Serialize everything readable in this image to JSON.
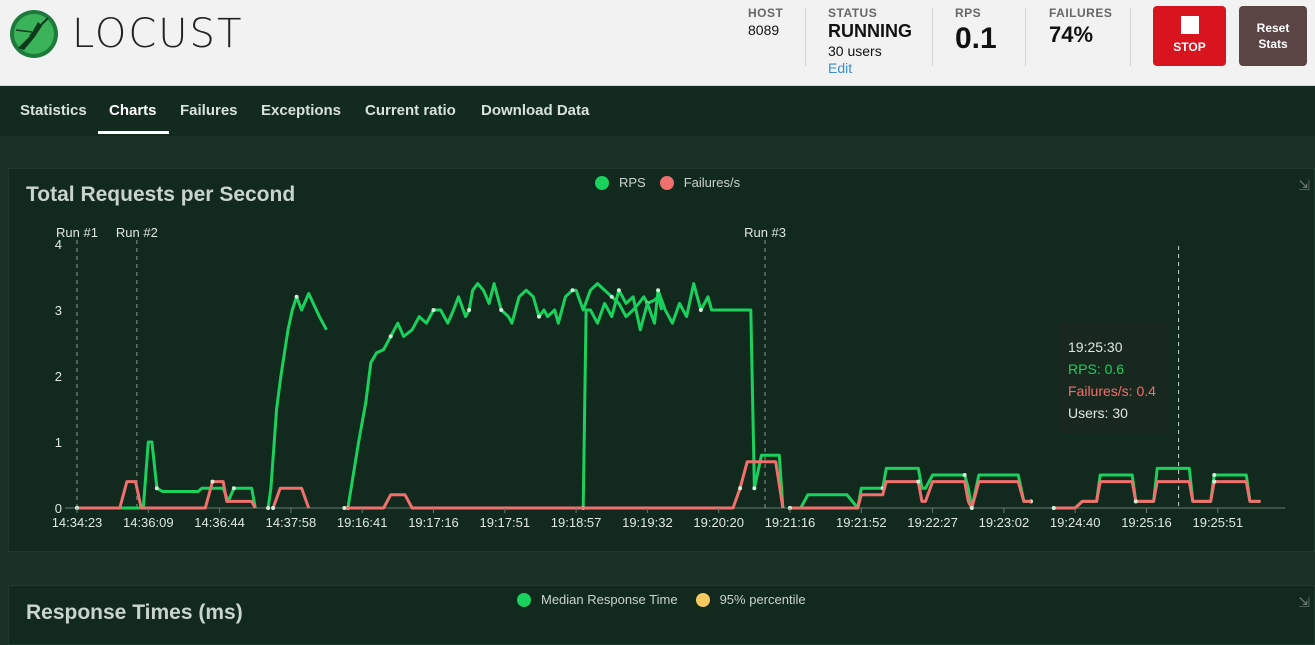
{
  "header": {
    "logo_text": "LOCUST",
    "host": {
      "label": "HOST",
      "value": "8089"
    },
    "status": {
      "label": "STATUS",
      "value": "RUNNING",
      "users": "30 users",
      "edit": "Edit"
    },
    "rps": {
      "label": "RPS",
      "value": "0.1"
    },
    "failures": {
      "label": "FAILURES",
      "value": "74%"
    },
    "stop_label": "STOP",
    "reset_label_1": "Reset",
    "reset_label_2": "Stats"
  },
  "nav": {
    "tabs": [
      "Statistics",
      "Charts",
      "Failures",
      "Exceptions",
      "Current ratio",
      "Download Data"
    ],
    "active": "Charts"
  },
  "colors": {
    "rps": "#19d15c",
    "failures": "#f0706e",
    "median": "#19d15c",
    "p95": "#f6c85e"
  },
  "chart1": {
    "title": "Total Requests per Second",
    "legend": [
      "RPS",
      "Failures/s"
    ],
    "tooltip": {
      "time": "19:25:30",
      "rps": "RPS: 0.6",
      "failures": "Failures/s: 0.4",
      "users": "Users: 30"
    }
  },
  "chart2": {
    "title": "Response Times (ms)",
    "legend": [
      "Median Response Time",
      "95% percentile"
    ]
  },
  "chart_data": {
    "type": "line",
    "title": "Total Requests per Second",
    "x_ticks": [
      "14:34:23",
      "14:36:09",
      "14:36:44",
      "14:37:58",
      "19:16:41",
      "19:17:16",
      "19:17:51",
      "19:18:57",
      "19:19:32",
      "19:20:20",
      "19:21:16",
      "19:21:52",
      "19:22:27",
      "19:23:02",
      "19:24:40",
      "19:25:16",
      "19:25:51"
    ],
    "ylim": [
      0,
      4
    ],
    "y_ticks": [
      0,
      1,
      2,
      3,
      4
    ],
    "markers": [
      {
        "label": "Run #1",
        "tick": 0
      },
      {
        "label": "Run #2",
        "tick": 0.84
      },
      {
        "label": "Run #3",
        "tick": 9.65
      }
    ],
    "cursor_tick": 15.45,
    "series": [
      {
        "name": "RPS",
        "segments": [
          [
            [
              0,
              0
            ],
            [
              0.6,
              0
            ],
            [
              0.85,
              0
            ],
            [
              0.93,
              0
            ],
            [
              1.0,
              1.0
            ],
            [
              1.05,
              1.0
            ],
            [
              1.12,
              0.3
            ],
            [
              1.2,
              0.25
            ],
            [
              1.7,
              0.25
            ],
            [
              1.75,
              0.3
            ],
            [
              2.05,
              0.3
            ],
            [
              2.12,
              0.1
            ],
            [
              2.2,
              0.3
            ],
            [
              2.45,
              0.3
            ],
            [
              2.5,
              0
            ]
          ],
          [
            [
              2.68,
              0
            ],
            [
              2.72,
              0.3
            ],
            [
              2.8,
              1.5
            ],
            [
              2.86,
              2.0
            ],
            [
              2.96,
              2.7
            ],
            [
              3.02,
              3.0
            ],
            [
              3.08,
              3.2
            ],
            [
              3.15,
              3.0
            ],
            [
              3.25,
              3.25
            ],
            [
              3.4,
              2.9
            ],
            [
              3.5,
              2.7
            ]
          ],
          [
            [
              3.8,
              0
            ],
            [
              3.95,
              1.0
            ],
            [
              4.05,
              1.6
            ],
            [
              4.12,
              2.2
            ],
            [
              4.2,
              2.35
            ],
            [
              4.3,
              2.4
            ],
            [
              4.4,
              2.6
            ],
            [
              4.5,
              2.8
            ],
            [
              4.58,
              2.6
            ],
            [
              4.7,
              2.7
            ],
            [
              4.8,
              2.9
            ],
            [
              4.9,
              2.8
            ],
            [
              5.0,
              3.0
            ],
            [
              5.1,
              3.0
            ],
            [
              5.2,
              2.8
            ],
            [
              5.28,
              3.0
            ],
            [
              5.35,
              3.2
            ],
            [
              5.45,
              2.9
            ],
            [
              5.5,
              3.0
            ],
            [
              5.55,
              3.3
            ],
            [
              5.62,
              3.4
            ],
            [
              5.7,
              3.3
            ],
            [
              5.78,
              3.1
            ],
            [
              5.85,
              3.4
            ],
            [
              5.95,
              3.0
            ],
            [
              6.05,
              2.9
            ],
            [
              6.1,
              2.8
            ],
            [
              6.2,
              3.2
            ],
            [
              6.3,
              3.3
            ],
            [
              6.4,
              3.2
            ],
            [
              6.48,
              2.9
            ],
            [
              6.55,
              3.0
            ],
            [
              6.6,
              2.9
            ],
            [
              6.7,
              3.0
            ],
            [
              6.75,
              2.8
            ],
            [
              6.85,
              3.2
            ],
            [
              6.95,
              3.3
            ],
            [
              7.0,
              3.3
            ],
            [
              7.1,
              3.0
            ],
            [
              7.2,
              3.3
            ],
            [
              7.3,
              3.4
            ],
            [
              7.4,
              3.3
            ],
            [
              7.5,
              3.2
            ],
            [
              7.6,
              3.1
            ],
            [
              7.7,
              2.9
            ],
            [
              7.8,
              3.0
            ],
            [
              7.88,
              3.1
            ],
            [
              7.95,
              3.2
            ],
            [
              8.0,
              3.1
            ],
            [
              8.1,
              3.15
            ],
            [
              8.15,
              3.2
            ],
            [
              8.2,
              3.0
            ]
          ],
          [
            [
              7.1,
              0
            ],
            [
              7.14,
              3.0
            ],
            [
              7.2,
              3.0
            ],
            [
              7.3,
              2.8
            ],
            [
              7.4,
              3.1
            ],
            [
              7.5,
              2.9
            ],
            [
              7.6,
              3.3
            ],
            [
              7.7,
              3.1
            ],
            [
              7.8,
              3.2
            ],
            [
              7.9,
              2.7
            ],
            [
              8.0,
              3.1
            ],
            [
              8.1,
              2.8
            ],
            [
              8.15,
              3.3
            ],
            [
              8.25,
              3.0
            ],
            [
              8.35,
              2.8
            ],
            [
              8.45,
              3.1
            ],
            [
              8.55,
              2.9
            ],
            [
              8.65,
              3.4
            ],
            [
              8.75,
              3.0
            ],
            [
              8.85,
              3.2
            ],
            [
              8.9,
              3.0
            ],
            [
              9.0,
              3.0
            ],
            [
              9.3,
              3.0
            ],
            [
              9.45,
              3.0
            ],
            [
              9.5,
              0.3
            ],
            [
              9.6,
              0.8
            ],
            [
              9.85,
              0.8
            ],
            [
              9.9,
              0
            ]
          ],
          [
            [
              10.0,
              0
            ],
            [
              10.15,
              0
            ],
            [
              10.25,
              0.2
            ],
            [
              10.8,
              0.2
            ],
            [
              10.95,
              0
            ],
            [
              11.0,
              0.3
            ],
            [
              11.3,
              0.3
            ],
            [
              11.35,
              0.6
            ],
            [
              11.8,
              0.6
            ],
            [
              11.85,
              0.3
            ],
            [
              11.9,
              0.3
            ],
            [
              12.0,
              0.5
            ],
            [
              12.45,
              0.5
            ],
            [
              12.5,
              0.3
            ],
            [
              12.55,
              0
            ],
            [
              12.65,
              0.5
            ],
            [
              13.2,
              0.5
            ],
            [
              13.28,
              0.1
            ],
            [
              13.38,
              0.1
            ]
          ],
          [
            [
              13.7,
              0
            ],
            [
              14.0,
              0
            ],
            [
              14.1,
              0.1
            ],
            [
              14.3,
              0.1
            ],
            [
              14.35,
              0.5
            ],
            [
              14.8,
              0.5
            ],
            [
              14.85,
              0.1
            ],
            [
              15.1,
              0.1
            ],
            [
              15.15,
              0.6
            ],
            [
              15.6,
              0.6
            ],
            [
              15.65,
              0.1
            ],
            [
              15.9,
              0.1
            ],
            [
              15.95,
              0.5
            ],
            [
              16.4,
              0.5
            ],
            [
              16.45,
              0.1
            ],
            [
              16.6,
              0.1
            ]
          ]
        ]
      },
      {
        "name": "Failures/s",
        "segments": [
          [
            [
              0,
              0
            ],
            [
              0.6,
              0
            ],
            [
              0.7,
              0.4
            ],
            [
              0.82,
              0.4
            ],
            [
              0.9,
              0
            ],
            [
              1.8,
              0
            ],
            [
              1.9,
              0.4
            ],
            [
              2.05,
              0.4
            ],
            [
              2.1,
              0.1
            ],
            [
              2.45,
              0.1
            ],
            [
              2.5,
              0
            ]
          ],
          [
            [
              2.75,
              0
            ],
            [
              2.85,
              0.3
            ],
            [
              3.15,
              0.3
            ],
            [
              3.25,
              0
            ]
          ],
          [
            [
              3.75,
              0
            ],
            [
              4.3,
              0
            ],
            [
              4.4,
              0.2
            ],
            [
              4.6,
              0.2
            ],
            [
              4.7,
              0
            ],
            [
              9.2,
              0
            ],
            [
              9.3,
              0.3
            ],
            [
              9.4,
              0.7
            ],
            [
              9.8,
              0.7
            ],
            [
              9.9,
              0
            ]
          ],
          [
            [
              10.0,
              0
            ],
            [
              10.8,
              0
            ],
            [
              10.95,
              0
            ],
            [
              11.0,
              0.2
            ],
            [
              11.3,
              0.2
            ],
            [
              11.35,
              0.4
            ],
            [
              11.8,
              0.4
            ],
            [
              11.85,
              0.1
            ],
            [
              11.9,
              0.1
            ],
            [
              12.0,
              0.4
            ],
            [
              12.45,
              0.4
            ],
            [
              12.5,
              0.1
            ],
            [
              12.55,
              0
            ],
            [
              12.65,
              0.4
            ],
            [
              13.2,
              0.4
            ],
            [
              13.28,
              0.1
            ],
            [
              13.38,
              0.1
            ]
          ],
          [
            [
              13.7,
              0
            ],
            [
              14.0,
              0
            ],
            [
              14.1,
              0.1
            ],
            [
              14.3,
              0.1
            ],
            [
              14.35,
              0.4
            ],
            [
              14.8,
              0.4
            ],
            [
              14.85,
              0.1
            ],
            [
              15.1,
              0.1
            ],
            [
              15.15,
              0.4
            ],
            [
              15.6,
              0.4
            ],
            [
              15.65,
              0.1
            ],
            [
              15.9,
              0.1
            ],
            [
              15.95,
              0.4
            ],
            [
              16.4,
              0.4
            ],
            [
              16.45,
              0.1
            ],
            [
              16.6,
              0.1
            ]
          ]
        ]
      }
    ]
  }
}
